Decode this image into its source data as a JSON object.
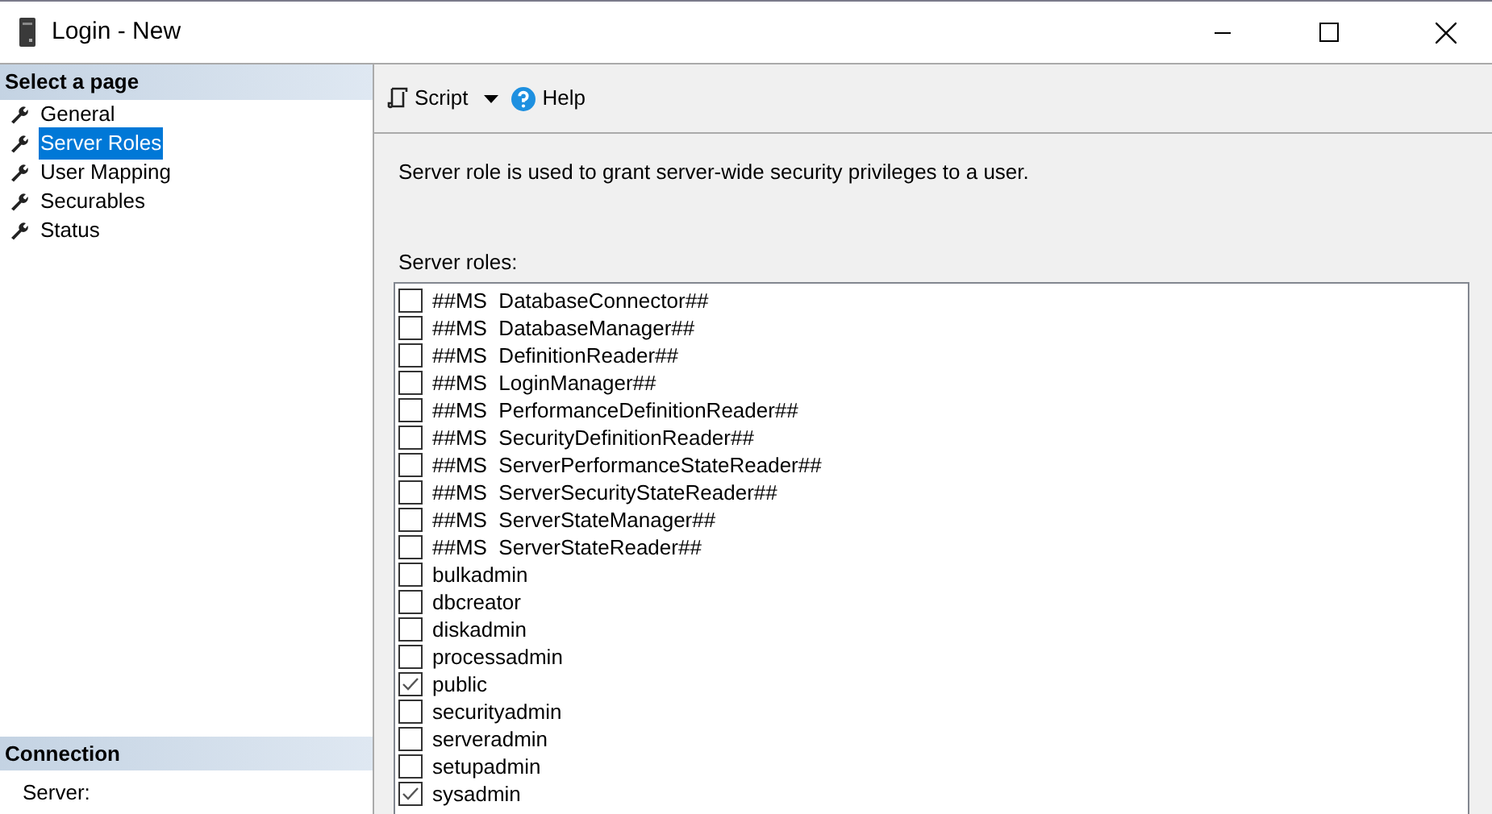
{
  "window": {
    "title": "Login - New"
  },
  "sidebar": {
    "header": "Select a page",
    "items": [
      {
        "label": "General",
        "selected": false
      },
      {
        "label": "Server Roles",
        "selected": true
      },
      {
        "label": "User Mapping",
        "selected": false
      },
      {
        "label": "Securables",
        "selected": false
      },
      {
        "label": "Status",
        "selected": false
      }
    ]
  },
  "connection": {
    "header": "Connection",
    "server_label": "Server:"
  },
  "toolbar": {
    "script": "Script",
    "help": "Help"
  },
  "description": "Server role is used to grant server-wide security privileges to a user.",
  "roles_label": "Server roles:",
  "roles": [
    {
      "name": "##MS  DatabaseConnector##",
      "checked": false
    },
    {
      "name": "##MS  DatabaseManager##",
      "checked": false
    },
    {
      "name": "##MS  DefinitionReader##",
      "checked": false
    },
    {
      "name": "##MS  LoginManager##",
      "checked": false
    },
    {
      "name": "##MS  PerformanceDefinitionReader##",
      "checked": false
    },
    {
      "name": "##MS  SecurityDefinitionReader##",
      "checked": false
    },
    {
      "name": "##MS  ServerPerformanceStateReader##",
      "checked": false
    },
    {
      "name": "##MS  ServerSecurityStateReader##",
      "checked": false
    },
    {
      "name": "##MS  ServerStateManager##",
      "checked": false
    },
    {
      "name": "##MS  ServerStateReader##",
      "checked": false
    },
    {
      "name": "bulkadmin",
      "checked": false
    },
    {
      "name": "dbcreator",
      "checked": false
    },
    {
      "name": "diskadmin",
      "checked": false
    },
    {
      "name": "processadmin",
      "checked": false
    },
    {
      "name": "public",
      "checked": true
    },
    {
      "name": "securityadmin",
      "checked": false
    },
    {
      "name": "serveradmin",
      "checked": false
    },
    {
      "name": "setupadmin",
      "checked": false
    },
    {
      "name": "sysadmin",
      "checked": true
    }
  ]
}
